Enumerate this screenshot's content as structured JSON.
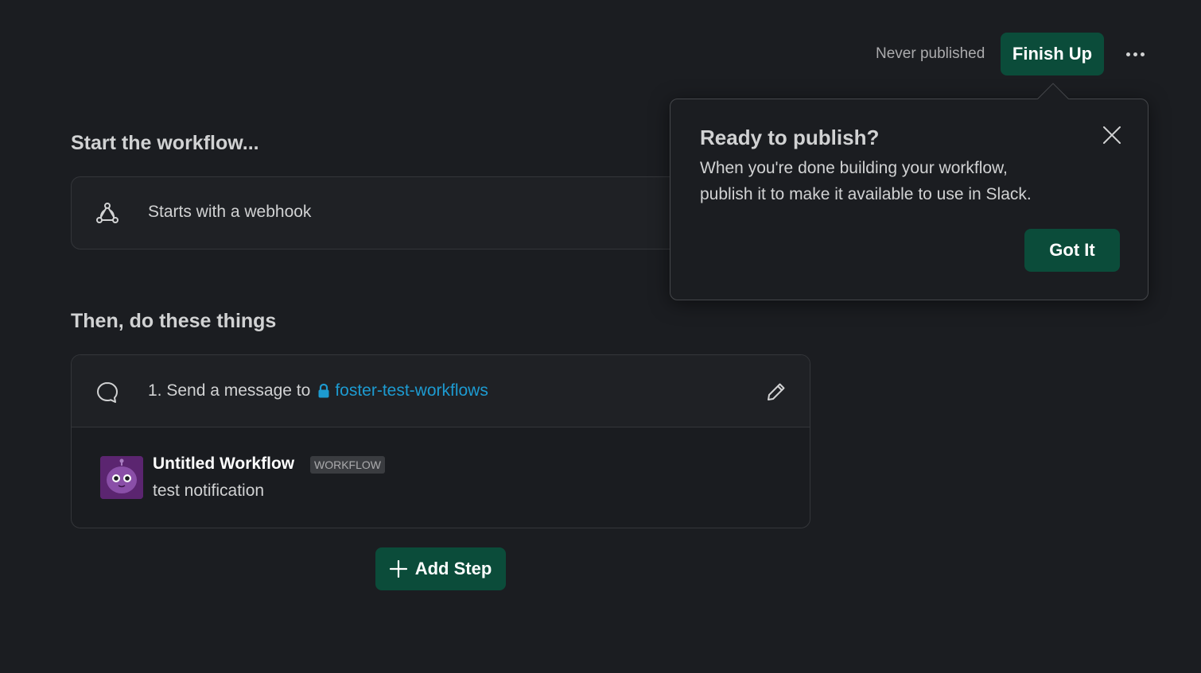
{
  "header": {
    "status": "Never published",
    "finish_label": "Finish Up",
    "more_icon": "ellipsis-icon"
  },
  "trigger": {
    "heading": "Start the workflow...",
    "label": "Starts with a webhook",
    "icon": "webhook-icon"
  },
  "steps": {
    "heading": "Then, do these things",
    "items": [
      {
        "prefix": "1. Send a message to",
        "channel": "foster-test-workflows",
        "icon": "message-bubble-icon",
        "channel_icon": "lock-icon",
        "edit_icon": "pencil-icon",
        "preview": {
          "author": "Untitled Workflow",
          "badge": "WORKFLOW",
          "text": "test notification"
        }
      }
    ],
    "add_label": "Add Step"
  },
  "popover": {
    "title": "Ready to publish?",
    "body_line1": "When you're done building your workflow,",
    "body_line2": "publish it to make it available to use in Slack.",
    "button_label": "Got It",
    "close_icon": "close-icon"
  },
  "colors": {
    "background": "#1b1d21",
    "primary_button": "#0b4c3a",
    "link": "#1d9bd1",
    "avatar": "#5b2570"
  }
}
